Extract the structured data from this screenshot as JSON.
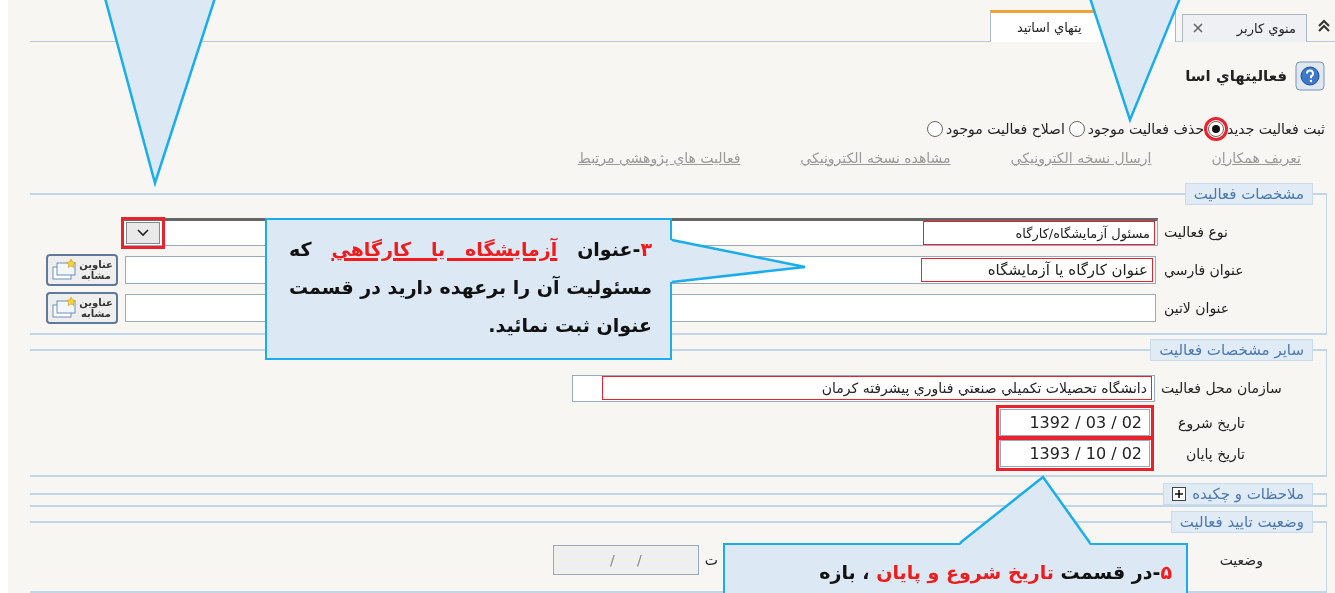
{
  "tabs": [
    {
      "label": "منوي كاربر",
      "closable": true,
      "selected": false
    },
    {
      "label": "يتهاي اساتيد",
      "closable": false,
      "selected": true
    }
  ],
  "page_title": "فعاليتهاي اسا",
  "modes": [
    {
      "label": "ثبت فعاليت جديد",
      "selected": true,
      "highlighted": true
    },
    {
      "label": "حذف فعاليت موجود",
      "selected": false,
      "highlighted": false
    },
    {
      "label": "اصلاح فعاليت موجود",
      "selected": false,
      "highlighted": false
    }
  ],
  "links": [
    "تعريف همكاران",
    "ارسال نسخه الكترونيكي",
    "مشاهده نسخه الكترونيكي",
    "فعاليت هاي پژوهشي مرتبط"
  ],
  "sections": [
    {
      "title": "مشخصات فعاليت",
      "expanded": true,
      "rows": [
        {
          "kind": "select",
          "label": "نوع فعاليت",
          "value": "مسئول آزمايشگاه/كارگاه",
          "highlighted": true,
          "button_highlighted": true
        },
        {
          "kind": "text",
          "label": "عنوان فارسي",
          "value": "عنوان كارگاه يا آزمايشگاه",
          "highlighted": true,
          "side_button": "عناوين مشابه"
        },
        {
          "kind": "text",
          "label": "عنوان لاتين",
          "side_button": "عناوين مشابه"
        }
      ]
    },
    {
      "title": "ساير مشخصات فعاليت",
      "expanded": true,
      "rows": [
        {
          "kind": "org",
          "label": "سازمان محل فعاليت",
          "value": "دانشگاه تحصيلات تكميلي  صنعتي فناوري پيشرفته كرمان",
          "highlighted": true
        },
        {
          "kind": "date",
          "label": "تاريخ شروع",
          "value": "1392 / 03 / 02",
          "highlighted": true
        },
        {
          "kind": "date",
          "label": "تاريخ پايان",
          "value": "1393 / 10 / 02",
          "highlighted": true
        }
      ]
    },
    {
      "title": "ملاحظات و چكيده",
      "expanded": false
    },
    {
      "title": "وضعيت تاييد فعاليت",
      "expanded": true,
      "rows": [
        {
          "kind": "status",
          "label": "وضعيت",
          "label_tail": "ت",
          "placeholder": "/     /"
        }
      ]
    }
  ],
  "callouts": [
    {
      "text": "*۳*-عنوان *آزمايشگاه يا كارگاهي* كه مسئوليت آن را برعهده داريد در قسمت عنوان ثبت نمائيد.",
      "underline": true
    },
    {
      "text": "*۵*-در قسمت *تاريخ شروع و پايان* ، بازه",
      "underline": false
    }
  ]
}
